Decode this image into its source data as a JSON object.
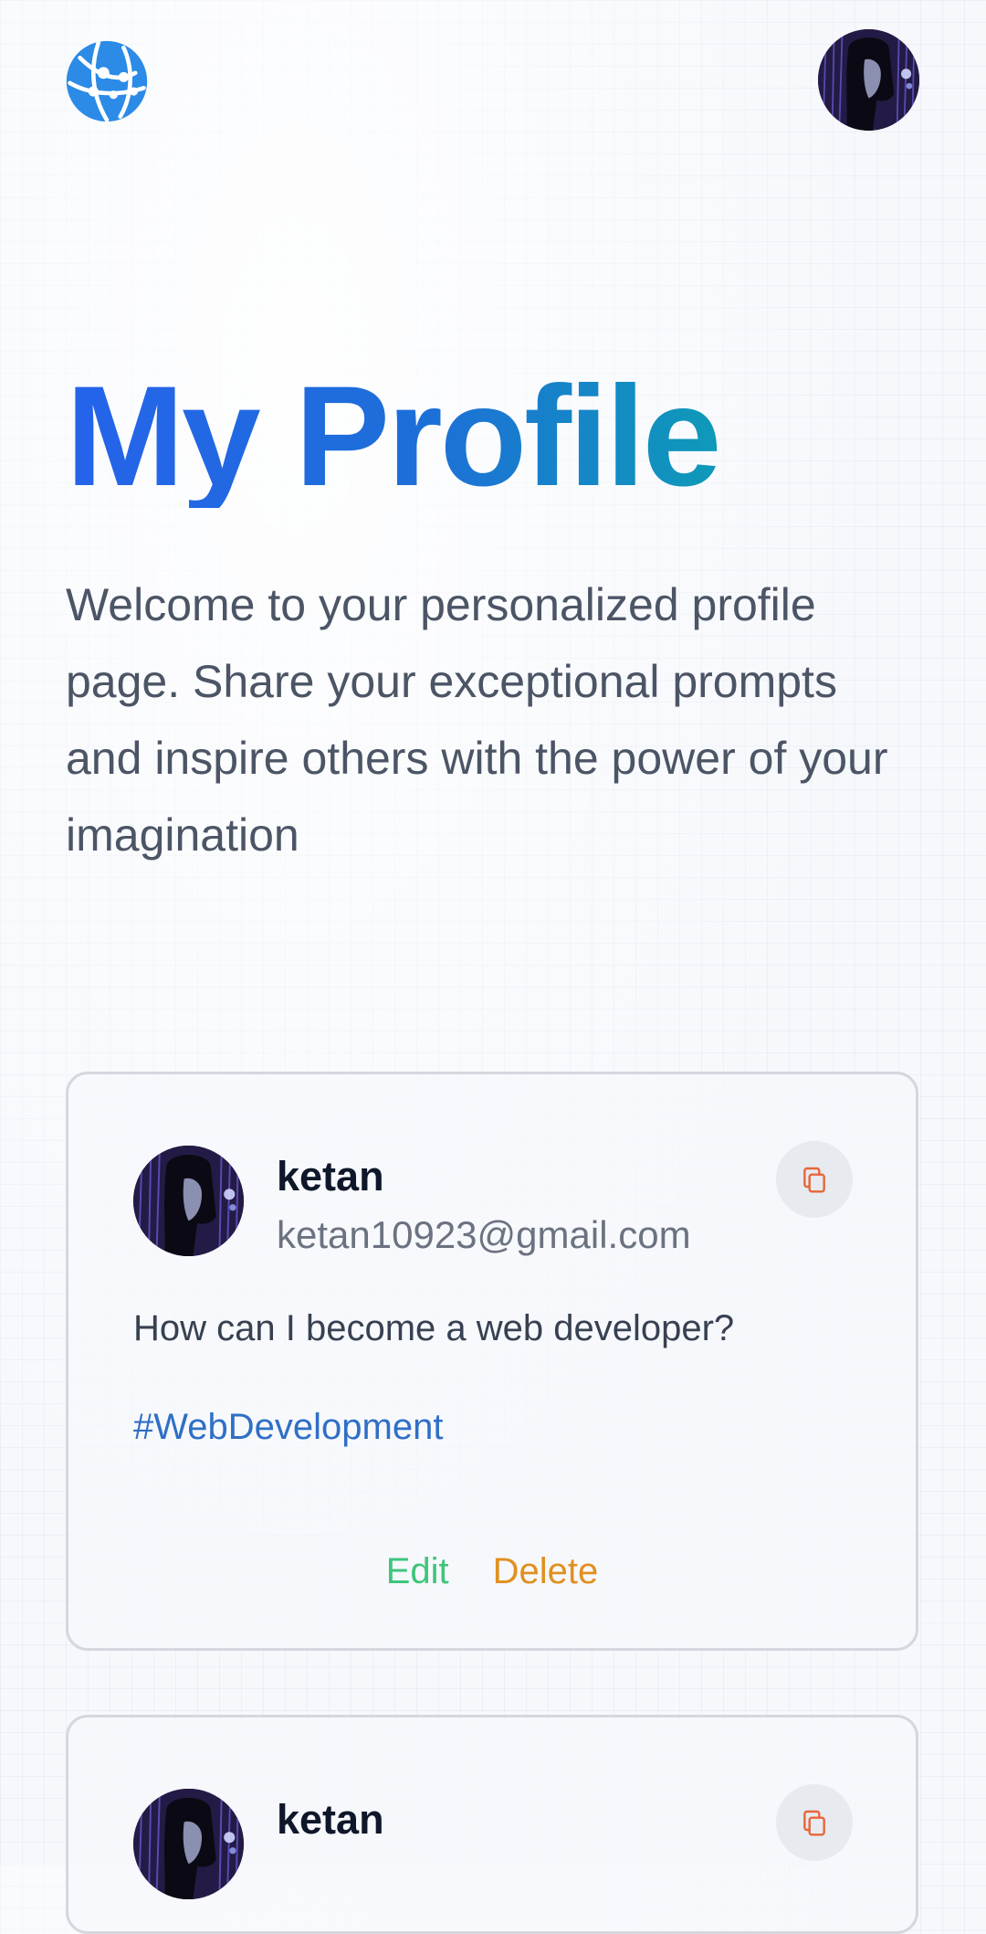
{
  "header": {
    "logo_icon": "globe-network-icon",
    "avatar_icon": "user-avatar"
  },
  "hero": {
    "title": "My Profile",
    "description": "Welcome to your personalized profile page. Share your exceptional prompts and inspire others with the power of your imagination"
  },
  "posts": [
    {
      "name": "ketan",
      "email": "ketan10923@gmail.com",
      "prompt": "How can I become a web developer?",
      "tag": "#WebDevelopment",
      "edit_label": "Edit",
      "delete_label": "Delete",
      "copy_icon": "copy-icon"
    },
    {
      "name": "ketan",
      "copy_icon": "copy-icon"
    }
  ],
  "colors": {
    "brand_blue": "#2563eb",
    "title_gradient_end": "#0e9ab8",
    "tag_blue": "#2f6fc6",
    "edit_green": "#3ec57a",
    "delete_orange": "#e0901f",
    "copy_icon_orange": "#e8653a"
  }
}
